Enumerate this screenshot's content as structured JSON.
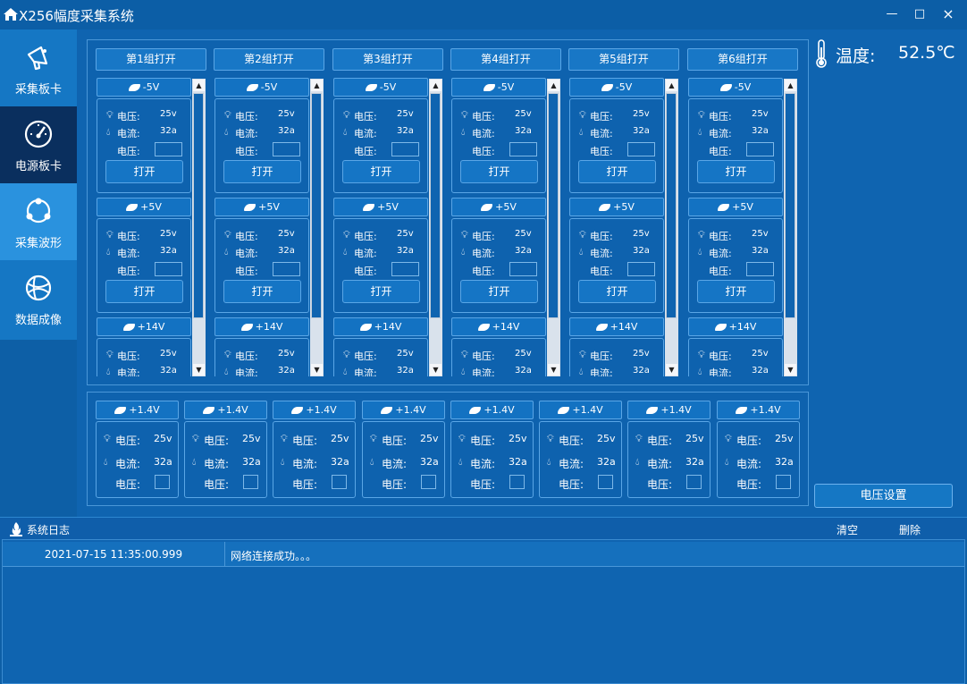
{
  "app": {
    "title": "X256幅度采集系统"
  },
  "window_controls": {
    "minimize": "—",
    "maximize": "□",
    "close": "×"
  },
  "sidebar": {
    "items": [
      {
        "label": "采集板卡",
        "icon": "megaphone-icon",
        "state": "normal"
      },
      {
        "label": "电源板卡",
        "icon": "gauge-icon",
        "state": "active"
      },
      {
        "label": "采集波形",
        "icon": "share-icon",
        "state": "hover"
      },
      {
        "label": "数据成像",
        "icon": "globe-icon",
        "state": "normal"
      }
    ]
  },
  "groups": [
    {
      "label": "第1组打开"
    },
    {
      "label": "第2组打开"
    },
    {
      "label": "第3组打开"
    },
    {
      "label": "第4组打开"
    },
    {
      "label": "第5组打开"
    },
    {
      "label": "第6组打开"
    }
  ],
  "rails": [
    {
      "name": "-5V",
      "voltage_label": "电压:",
      "voltage_value": "25v",
      "current_label": "电流:",
      "current_value": "32a",
      "set_label": "电压:",
      "open_label": "打开"
    },
    {
      "name": "+5V",
      "voltage_label": "电压:",
      "voltage_value": "25v",
      "current_label": "电流:",
      "current_value": "32a",
      "set_label": "电压:",
      "open_label": "打开"
    },
    {
      "name": "+14V",
      "voltage_label": "电压:",
      "voltage_value": "25v",
      "current_label": "电流:",
      "current_value": "32a"
    }
  ],
  "bottom_cards": {
    "name": "+1.4V",
    "voltage_label": "电压:",
    "voltage_value": "25v",
    "current_label": "电流:",
    "current_value": "32a",
    "set_label": "电压:",
    "count": 8
  },
  "temperature": {
    "label": "温度:",
    "value": "52.5℃"
  },
  "voltage_settings": {
    "label": "电压设置"
  },
  "log": {
    "title": "系统日志",
    "clear": "清空",
    "delete": "删除",
    "entries": [
      {
        "time": "2021-07-15 11:35:00.999",
        "message": "网络连接成功。。。"
      }
    ]
  },
  "colors": {
    "background": "#0d5fa6",
    "active_nav": "#0a2f5e",
    "hover_nav": "#2a92de",
    "border": "#5aa6e6"
  }
}
